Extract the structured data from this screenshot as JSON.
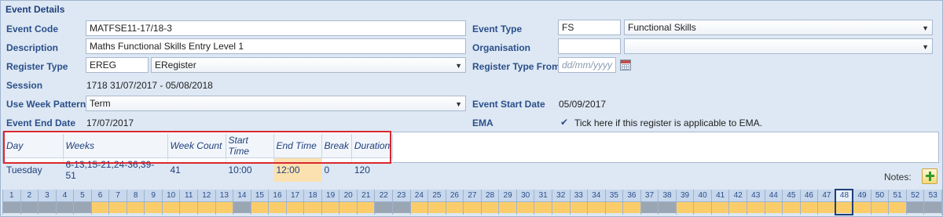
{
  "section_title": "Event Details",
  "fields": {
    "event_code": {
      "label": "Event Code",
      "value": "MATFSE11-17/18-3"
    },
    "description": {
      "label": "Description",
      "value": "Maths Functional Skills Entry Level 1"
    },
    "register_type": {
      "label": "Register Type",
      "code": "EREG",
      "value": "ERegister"
    },
    "session": {
      "label": "Session",
      "value": "1718  31/07/2017 - 05/08/2018"
    },
    "use_week_pattern": {
      "label": "Use Week Pattern",
      "value": "Term"
    },
    "event_end_date": {
      "label": "Event End Date",
      "value": "17/07/2017"
    },
    "event_type": {
      "label": "Event Type",
      "code": "FS",
      "value": "Functional Skills"
    },
    "organisation": {
      "label": "Organisation",
      "code": "",
      "value": ""
    },
    "register_type_from": {
      "label": "Register Type From",
      "placeholder": "dd/mm/yyyy"
    },
    "event_start_date": {
      "label": "Event Start Date",
      "value": "05/09/2017"
    },
    "ema": {
      "label": "EMA",
      "check": "✔",
      "text": "Tick here if this register is applicable to EMA."
    }
  },
  "pattern_table": {
    "headers": [
      "Day",
      "Weeks",
      "Week Count",
      "Start Time",
      "End Time",
      "Break",
      "Duration"
    ],
    "row": [
      "Tuesday",
      "6-13,15-21,24-36,39-51",
      "41",
      "10:00",
      "12:00",
      "0",
      "120"
    ]
  },
  "notes_label": "Notes:",
  "weeks": {
    "numbers": [
      "1",
      "2",
      "3",
      "4",
      "5",
      "6",
      "7",
      "8",
      "9",
      "10",
      "11",
      "12",
      "13",
      "14",
      "15",
      "16",
      "17",
      "18",
      "19",
      "20",
      "21",
      "22",
      "23",
      "24",
      "25",
      "26",
      "27",
      "28",
      "29",
      "30",
      "31",
      "32",
      "33",
      "34",
      "35",
      "36",
      "37",
      "38",
      "39",
      "40",
      "41",
      "42",
      "43",
      "44",
      "45",
      "46",
      "47",
      "48",
      "49",
      "50",
      "51",
      "52",
      "53"
    ],
    "active_ranges": "6-13,15-21,24-36,39-51",
    "current_week": "48"
  },
  "colors": {
    "label": "#2b4f8a",
    "highlight_border": "#d9282f",
    "active_week": "#fbcd6a",
    "inactive_week": "#9ba6b4"
  }
}
